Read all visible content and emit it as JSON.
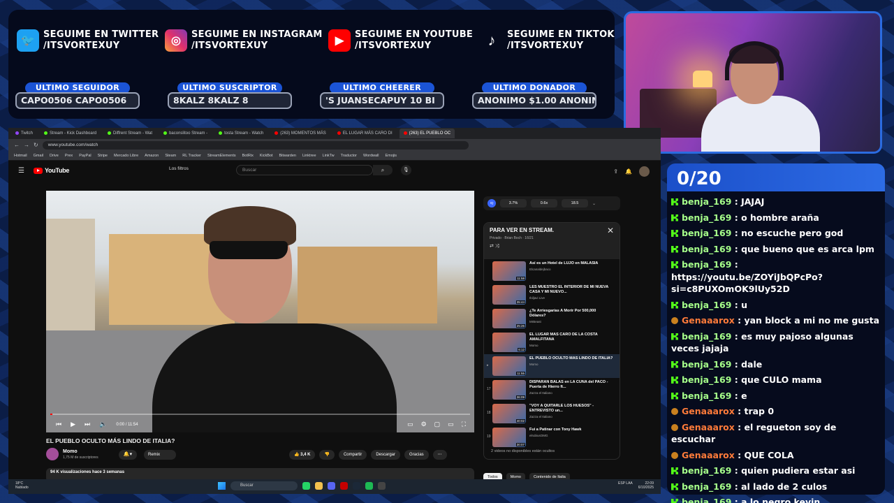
{
  "socials": [
    {
      "icon": "twitter-icon",
      "line1": "SEGUIME EN TWITTER",
      "line2": "/ITSVORTEXUY"
    },
    {
      "icon": "instagram-icon",
      "line1": "SEGUIME EN INSTAGRAM",
      "line2": "/ITSVORTEXUY"
    },
    {
      "icon": "youtube-icon",
      "line1": "SEGUIME EN YOUTUBE",
      "line2": "/ITSVORTEXUY"
    },
    {
      "icon": "tiktok-icon",
      "line1": "SEGUIME EN TIKTOK",
      "line2": "/ITSVORTEXUY"
    }
  ],
  "stats": [
    {
      "label": "ULTIMO SEGUIDOR",
      "value": "CAPO0506      CAPO0506"
    },
    {
      "label": "ULTIMO SUSCRIPTOR",
      "value": "8KALZ      8KALZ      8"
    },
    {
      "label": "ULTIMO CHEERER",
      "value": "'S      JUANSECAPUY 10 BI"
    },
    {
      "label": "ULTIMO DONADOR",
      "value": "ANONIMO $1.00    ANONIM"
    }
  ],
  "browser": {
    "tabs": [
      "Twitch",
      "Stream - Kick Dashboard",
      "Diffrent Stream - Wat",
      "baconslitoo Stream -",
      "tosta Stream - Watch",
      "(263) MOMENTOS MÁS",
      "EL LUGAR MÁS CARO DI",
      "(263) EL PUEBLO OC"
    ],
    "url": "www.youtube.com/watch",
    "bookmarks": [
      "Hotmail",
      "Gmail",
      "Drive",
      "Prex",
      "PayPal",
      "Stripe",
      "Mercado Libre",
      "Amazon",
      "Steam",
      "RL Tracker",
      "StreamElements",
      "BotRix",
      "KickBot",
      "Bitwarden",
      "Linktree",
      "LinkTw",
      "Traductor",
      "Wordwall",
      "Emojis"
    ]
  },
  "youtube": {
    "logo": "YouTube",
    "filters": "Los filtros",
    "search_placeholder": "Buscar",
    "video": {
      "time": "0:00 / 11:54",
      "title": "EL PUEBLO OCULTO MÁS LINDO DE ITALIA?",
      "channel": "Momo",
      "subs": "1,75 M de suscriptores",
      "remix": "Remix",
      "likes": "3,4 K",
      "share": "Compartir",
      "download": "Descargar",
      "thanks": "Gracias",
      "views": "94 K visualizaciones  hace 3 semanas"
    },
    "ext_values": [
      "3.7%",
      "0.6x",
      "18.5"
    ],
    "playlist": {
      "title": "PARA VER EN STREAM.",
      "privacy": "Privado",
      "owner": "Brian Boch · 16/21",
      "items": [
        {
          "idx": "",
          "title": "Así es un Hotel de LUJO en MALASIA",
          "channel": "Elcanaldejbaco",
          "duration": "11:58"
        },
        {
          "idx": "",
          "title": "LES MUESTRO EL INTERIOR DE MI NUEVA CASA Y MI NUEVO...",
          "channel": "Ibiljavi Live",
          "duration": "35:44"
        },
        {
          "idx": "",
          "title": "¿Te Arriesgarías A Morir Por 500,000 Dólares?",
          "channel": "MrBeast",
          "duration": "25:26"
        },
        {
          "idx": "",
          "title": "EL LUGAR MÁS CARO DE LA COSTA AMALFITANA",
          "channel": "Momo",
          "duration": "6:12"
        },
        {
          "idx": "▸",
          "title": "EL PUEBLO OCULTO MÁS LINDO DE ITALIA?",
          "channel": "Momo",
          "duration": "11:55"
        },
        {
          "idx": "17",
          "title": "DISPARAN BALAS en LA CUNA del PACO - Puerta de Hierro ft...",
          "channel": "Zazza el Italiano",
          "duration": "36:09"
        },
        {
          "idx": "18",
          "title": "\"VOY A QUITARLE LOS HUESOS\" - ENTREVISTO un...",
          "channel": "Zazza el Italiano",
          "duration": "40:02"
        },
        {
          "idx": "19",
          "title": "Fui a Patinar con Tony Hawk",
          "channel": "elrubiusOMG",
          "duration": "30:07"
        }
      ],
      "hidden_note": "2 videos no disponibles están ocultos"
    },
    "chips": [
      "Todos",
      "Momo",
      "Contenido de Italia"
    ]
  },
  "taskbar": {
    "temp": "18°C",
    "weather": "Nublado",
    "search": "Buscar",
    "lang": "ESP LAA",
    "time": "22:09",
    "date": "6/10/2025"
  },
  "chat": {
    "counter": "0/20",
    "messages": [
      {
        "badge": "kick",
        "user": "benja_169",
        "text": "JAJAJ",
        "color": "green"
      },
      {
        "badge": "kick",
        "user": "benja_169",
        "text": "o hombre araña",
        "color": "green"
      },
      {
        "badge": "kick",
        "user": "benja_169",
        "text": "no escuche pero god",
        "color": "green"
      },
      {
        "badge": "kick",
        "user": "benja_169",
        "text": "que bueno que es arca lpm",
        "color": "green"
      },
      {
        "badge": "kick",
        "user": "benja_169",
        "text": "https://youtu.be/ZOYiJbQPcPo?si=c8PUXOmOK9lUy52D",
        "color": "green"
      },
      {
        "badge": "kick",
        "user": "benja_169",
        "text": "u",
        "color": "green"
      },
      {
        "badge": "twitch",
        "user": "Genaaarox",
        "text": "yan block a mi no me gusta",
        "color": "orange"
      },
      {
        "badge": "kick",
        "user": "benja_169",
        "text": "es muy pajoso algunas veces jajaja",
        "color": "green"
      },
      {
        "badge": "kick",
        "user": "benja_169",
        "text": "dale",
        "color": "green"
      },
      {
        "badge": "kick",
        "user": "benja_169",
        "text": "que CULO mama",
        "color": "green"
      },
      {
        "badge": "kick",
        "user": "benja_169",
        "text": "e",
        "color": "green"
      },
      {
        "badge": "twitch",
        "user": "Genaaarox",
        "text": "trap 0",
        "color": "orange"
      },
      {
        "badge": "twitch",
        "user": "Genaaarox",
        "text": "el regueton soy de escuchar",
        "color": "orange"
      },
      {
        "badge": "twitch",
        "user": "Genaaarox",
        "text": "QUE COLA",
        "color": "orange"
      },
      {
        "badge": "kick",
        "user": "benja_169",
        "text": "quien pudiera estar asi",
        "color": "green"
      },
      {
        "badge": "kick",
        "user": "benja_169",
        "text": "al lado de 2 culos",
        "color": "green"
      },
      {
        "badge": "kick",
        "user": "benja_169",
        "text": "a lo negro kevin",
        "color": "green"
      }
    ]
  },
  "colors": {
    "accent": "#1b54d6",
    "kick_green": "#53fc18",
    "twitch_name": "#ff7b3a"
  }
}
